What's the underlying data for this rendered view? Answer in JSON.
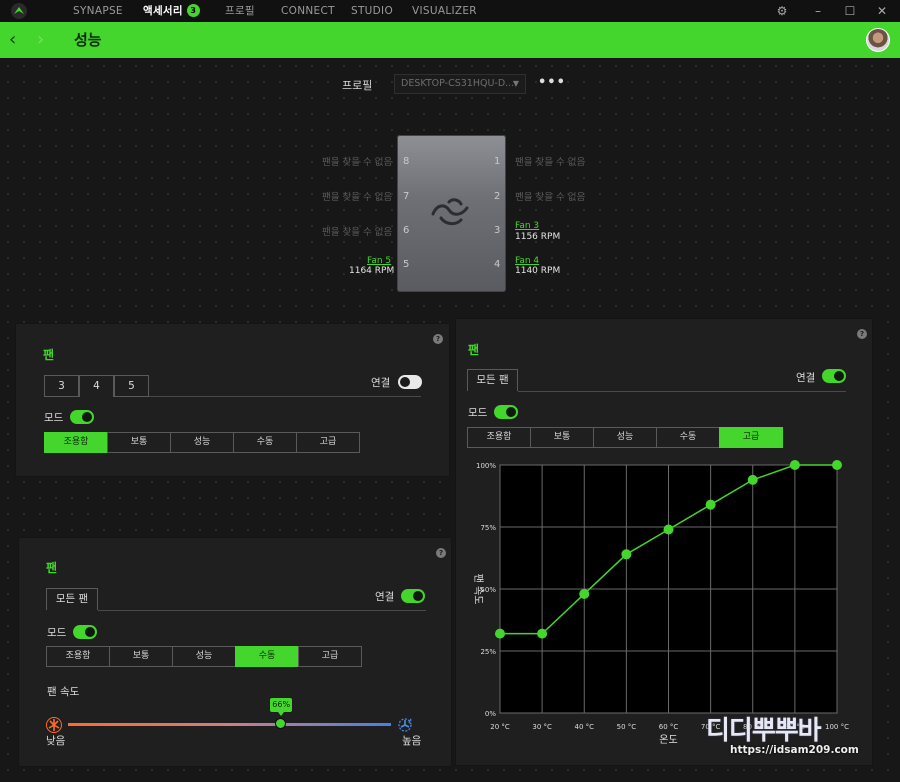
{
  "nav": {
    "tabs": [
      "SYNAPSE",
      "액세서리",
      "프로필",
      "CONNECT",
      "STUDIO",
      "VISUALIZER"
    ],
    "active_tab": "액세서리",
    "accessory_badge": "3"
  },
  "header": {
    "title": "성능"
  },
  "profile": {
    "label": "프로필",
    "value": "DESKTOP-CS31HQU-D...",
    "more": "•••"
  },
  "device": {
    "left_ports": [
      {
        "num": "8",
        "label": "팬을 찾을 수 없음"
      },
      {
        "num": "7",
        "label": "팬을 찾을 수 없음"
      },
      {
        "num": "6",
        "label": "팬을 찾을 수 없음"
      },
      {
        "num": "5",
        "fan": "Fan 5",
        "rpm": "1164 RPM"
      }
    ],
    "right_ports": [
      {
        "num": "1",
        "label": "팬을 찾을 수 없음"
      },
      {
        "num": "2",
        "label": "팬을 찾을 수 없음"
      },
      {
        "num": "3",
        "fan": "Fan 3",
        "rpm": "1156 RPM"
      },
      {
        "num": "4",
        "fan": "Fan 4",
        "rpm": "1140 RPM"
      }
    ]
  },
  "panel1": {
    "title": "팬",
    "tabs": [
      "3",
      "4",
      "5"
    ],
    "connect_label": "연결",
    "connect_on": false,
    "mode_label": "모드",
    "mode_on": true,
    "modes": [
      "조용함",
      "보통",
      "성능",
      "수동",
      "고급"
    ],
    "active_mode": "조용함"
  },
  "panel2": {
    "title": "팬",
    "tabs": [
      "모든 팬"
    ],
    "connect_label": "연결",
    "connect_on": true,
    "mode_label": "모드",
    "mode_on": true,
    "modes": [
      "조용함",
      "보통",
      "성능",
      "수동",
      "고급"
    ],
    "active_mode": "수동",
    "speed_label": "팬 속도",
    "speed_value": "66%",
    "speed_fraction": 0.66,
    "low_label": "낮음",
    "high_label": "높음"
  },
  "panel3": {
    "title": "팬",
    "tabs": [
      "모든 팬"
    ],
    "connect_label": "연결",
    "connect_on": true,
    "mode_label": "모드",
    "mode_on": true,
    "modes": [
      "조용함",
      "보통",
      "성능",
      "수동",
      "고급"
    ],
    "active_mode": "고급"
  },
  "watermark": {
    "brand": "디디뿌뿌바",
    "url": "https://idsam209.com"
  },
  "chart_data": {
    "type": "line",
    "xlabel": "온도",
    "ylabel": "팬 속도",
    "x": [
      20,
      30,
      40,
      50,
      60,
      70,
      80,
      90,
      100
    ],
    "x_tick_labels": [
      "20 °C",
      "30 °C",
      "40 °C",
      "50 °C",
      "60 °C",
      "70 °C",
      "80 °C",
      "90 °C",
      "100 °C"
    ],
    "y_tick_labels": [
      "0%",
      "25%",
      "50%",
      "75%",
      "100%"
    ],
    "ylim": [
      0,
      100
    ],
    "xlim": [
      20,
      100
    ],
    "grid": true,
    "series": [
      {
        "values": [
          32,
          32,
          48,
          64,
          74,
          84,
          94,
          100,
          100
        ]
      }
    ],
    "line_color": "#44d62c"
  }
}
